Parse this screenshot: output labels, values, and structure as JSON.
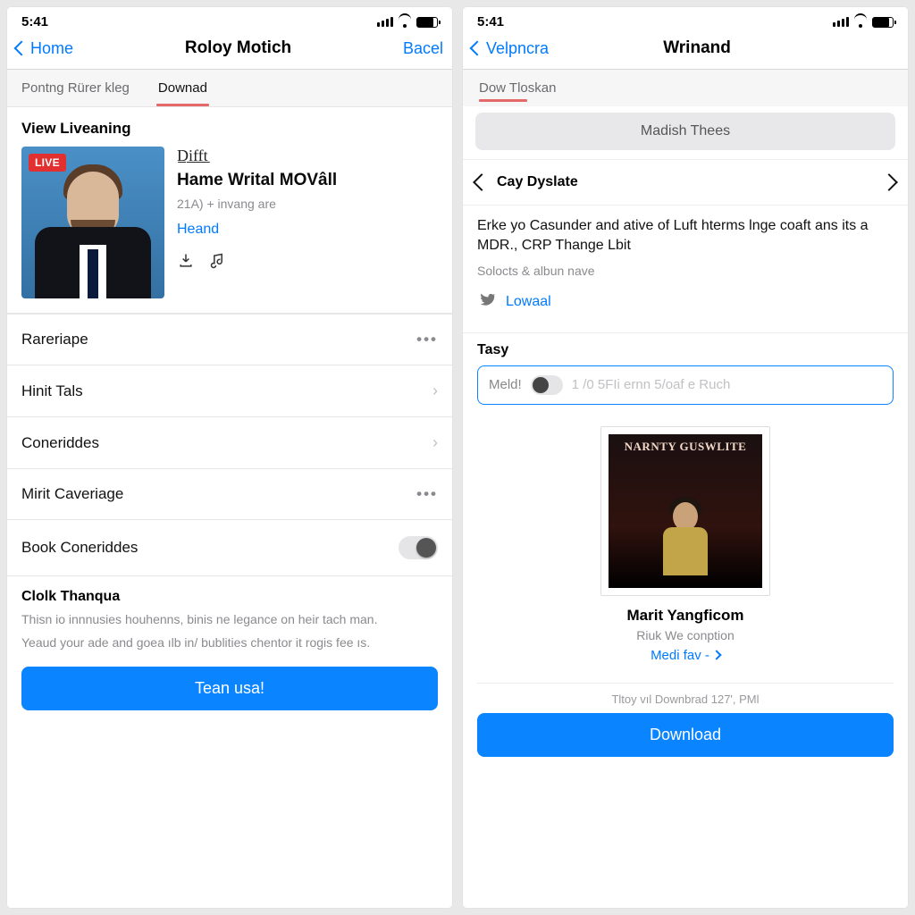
{
  "statusbar": {
    "time": "5:41"
  },
  "left": {
    "nav": {
      "back": "Home",
      "title": "Roloy Motich",
      "right": "Bacel"
    },
    "tabs": [
      {
        "label": "Pontng Rürer kleg"
      },
      {
        "label": "Downad",
        "active": true
      }
    ],
    "section_title": "View Liveaning",
    "card": {
      "live": "LIVE",
      "eyebrow": "D̲i̲f̲f̲t̲",
      "name": "Hame Writal MOVâll",
      "sub": "21A) + invang are",
      "link": "Heand"
    },
    "rows": [
      {
        "label": "Rareriape",
        "type": "dots"
      },
      {
        "label": "Hinit Tals",
        "type": "chevron"
      },
      {
        "label": "Coneriddes",
        "type": "chevron"
      },
      {
        "label": "Mirit Caveriage",
        "type": "dots"
      },
      {
        "label": "Book Coneriddes",
        "type": "toggle"
      }
    ],
    "footer": {
      "title": "Clolk Thanqua",
      "d1": "Thisn io innnusies houhenns, binis ne legance on heir tach man.",
      "d2": "Yeaud your ade and goea ılb in/ bublities chentor it rogis fee ıs.",
      "button": "Tean usa!"
    }
  },
  "right": {
    "nav": {
      "back": "Velpncra",
      "title": "Wrinand"
    },
    "tab": "Dow Tloskan",
    "segment": "Madish Thees",
    "pager": "Cay Dyslate",
    "article": {
      "body": "Erke yo Casunder and ative of Luft hterms lnge coaft ans its a MDR., CRP Thange Lbit",
      "sub": "Solocts & albun nave",
      "share": "Lowaal"
    },
    "field": {
      "label": "Tasy",
      "tag": "Meld!",
      "placeholder": "1 /0 5FIi ernn 5/oaf e Ruch"
    },
    "album": {
      "cover_title": "NARNTY GUSWLITE",
      "name": "Marit Yangficom",
      "sub": "Riuk We conption",
      "link": "Medi fav -"
    },
    "dl_note": "Tltoy vıl Downbrad 127', PMl",
    "button": "Download"
  }
}
